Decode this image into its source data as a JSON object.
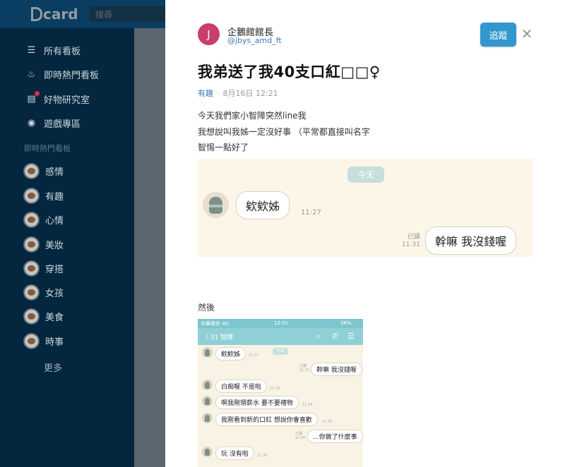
{
  "app": {
    "logo": "card",
    "search_placeholder": "搜尋"
  },
  "sidebar": {
    "main_items": [
      {
        "label": "所有看板",
        "icon": "list-icon"
      },
      {
        "label": "即時熱門看板",
        "icon": "flame-icon"
      },
      {
        "label": "好物研究室",
        "icon": "store-icon"
      },
      {
        "label": "遊戲專區",
        "icon": "gamepad-icon"
      }
    ],
    "section_title": "即時熱門看板",
    "boards": [
      {
        "label": "感情"
      },
      {
        "label": "有趣"
      },
      {
        "label": "心情"
      },
      {
        "label": "美妝"
      },
      {
        "label": "穿搭"
      },
      {
        "label": "女孩"
      },
      {
        "label": "美食"
      },
      {
        "label": "時事"
      }
    ],
    "more_label": "更多"
  },
  "post": {
    "author_initial": "J",
    "author_name": "企鵝館館長",
    "author_handle": "@jbys_amd_ft",
    "follow_label": "追蹤",
    "close_icon": "close-icon",
    "title": "我弟送了我40支口紅□□♀",
    "category": "有趣",
    "separator": "·",
    "time": "8月16日 12:21",
    "body_lines": [
      "今天我們家小智障突然line我",
      "我想說叫我姊一定沒好事 （平常都直接叫名字",
      "智惕一點好了"
    ],
    "then_label": "然後"
  },
  "chat_image": {
    "date_label": "今天",
    "left_message": "欸欸姊",
    "left_time": "11:27",
    "read_label": "已讀",
    "right_time": "11:31",
    "right_message": "幹嘛 我沒錢喔"
  },
  "phone_image": {
    "carrier": "中華電信 4G",
    "clock": "12:01",
    "battery": "36%",
    "back_label": "〈 31  智障",
    "date_label": "今天",
    "messages": [
      {
        "side": "left",
        "text": "欸欸姊",
        "time": "11:27"
      },
      {
        "side": "right",
        "text": "幹嘛 我沒錢喔",
        "time": "11:31"
      },
      {
        "side": "left",
        "text": "白痴喔 不是啦",
        "time": "11:33"
      },
      {
        "side": "left",
        "text": "啊我剛領薪水 要不要禮物",
        "time": "11:34"
      },
      {
        "side": "left",
        "text": "我剛看到新的口紅 想說你會喜歡",
        "time": "11:35"
      },
      {
        "side": "right",
        "text": "...你做了什麼事",
        "time": "11:36"
      },
      {
        "side": "left",
        "text": "玩 沒有啦",
        "time": "11:36"
      }
    ],
    "read_label": "已讀"
  }
}
